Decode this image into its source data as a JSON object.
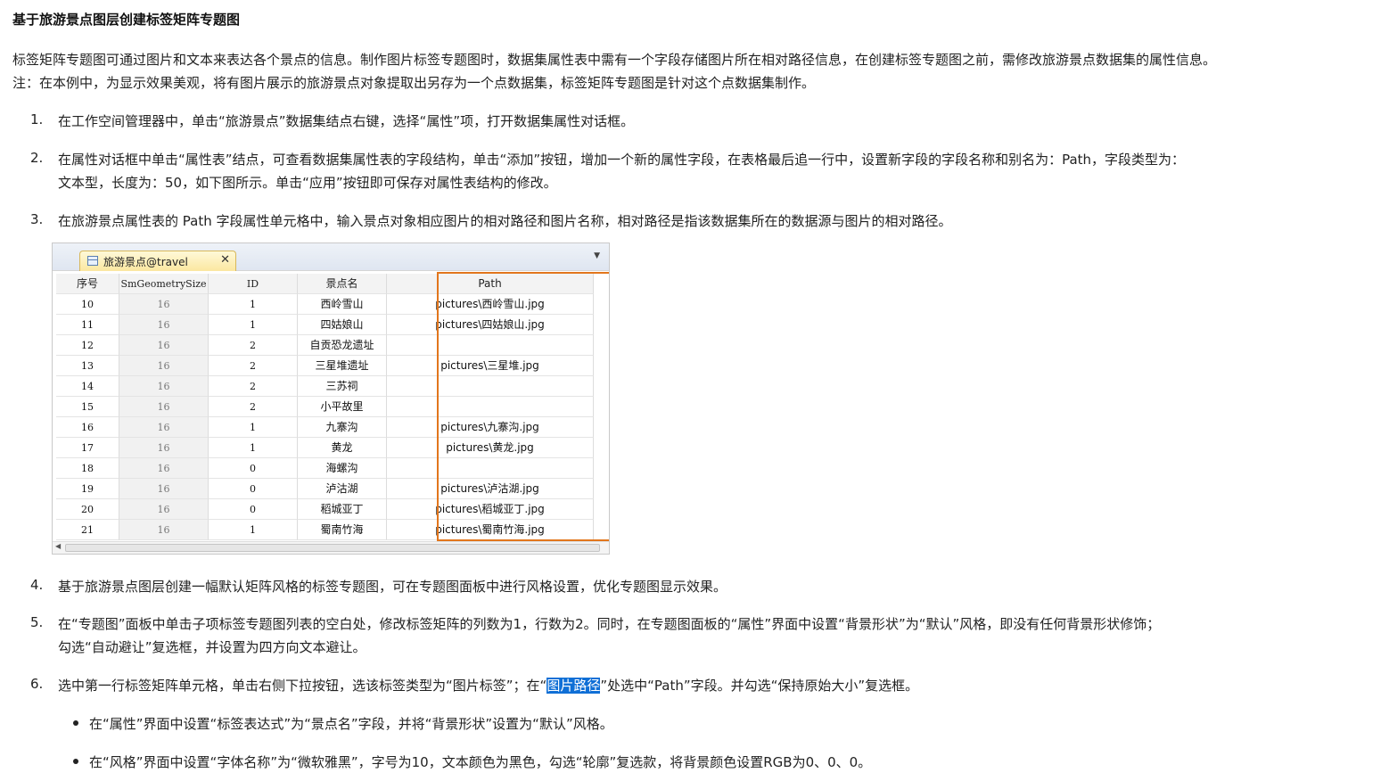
{
  "title": "基于旅游景点图层创建标签矩阵专题图",
  "intro": [
    "标签矩阵专题图可通过图片和文本来表达各个景点的信息。制作图片标签专题图时，数据集属性表中需有一个字段存储图片所在相对路径信息，在创建标签专题图之前，需修改旅游景点数据集的属性信息。",
    "注：在本例中，为显示效果美观，将有图片展示的旅游景点对象提取出另存为一个点数据集，标签矩阵专题图是针对这个点数据集制作。"
  ],
  "steps": [
    {
      "num": "1.",
      "lines": [
        "在工作空间管理器中，单击“旅游景点”数据集结点右键，选择“属性”项，打开数据集属性对话框。"
      ]
    },
    {
      "num": "2.",
      "lines": [
        "在属性对话框中单击“属性表”结点，可查看数据集属性表的字段结构，单击“添加”按钮，增加一个新的属性字段，在表格最后追一行中，设置新字段的字段名称和别名为：Path，字段类型为：",
        "文本型，长度为：50，如下图所示。单击“应用”按钮即可保存对属性表结构的修改。"
      ]
    },
    {
      "num": "3.",
      "lines": [
        "在旅游景点属性表的 Path 字段属性单元格中，输入景点对象相应图片的相对路径和图片名称，相对路径是指该数据集所在的数据源与图片的相对路径。"
      ]
    },
    {
      "num": "4.",
      "lines": [
        "基于旅游景点图层创建一幅默认矩阵风格的标签专题图，可在专题图面板中进行风格设置，优化专题图显示效果。"
      ]
    },
    {
      "num": "5.",
      "lines": [
        "在“专题图”面板中单击子项标签专题图列表的空白处，修改标签矩阵的列数为1，行数为2。同时，在专题图面板的“属性”界面中设置“背景形状”为“默认”风格，即没有任何背景形状修饰；",
        "勾选“自动避让”复选框，并设置为四方向文本避让。"
      ]
    },
    {
      "num": "6.",
      "pre": "选中第一行标签矩阵单元格，单击右侧下拉按钮，选该标签类型为“图片标签”；在“",
      "highlight": "图片路径",
      "post": "”处选中“Path”字段。并勾选“保持原始大小”复选框。"
    }
  ],
  "bullets": [
    "在“属性”界面中设置“标签表达式”为“景点名”字段，并将“背景形状”设置为“默认”风格。",
    "在“风格”界面中设置“字体名称”为“微软雅黑”，字号为10，文本颜色为黑色，勾选“轮廓”复选款，将背景颜色设置RGB为0、0、0。"
  ],
  "table": {
    "tab_label": "旅游景点@travel",
    "tab_close": "✕",
    "headers": [
      "序号",
      "SmGeometrySize",
      "ID",
      "景点名",
      "Path"
    ],
    "rows": [
      [
        "10",
        "16",
        "1",
        "西岭雪山",
        "pictures\\西岭雪山.jpg"
      ],
      [
        "11",
        "16",
        "1",
        "四姑娘山",
        "pictures\\四姑娘山.jpg"
      ],
      [
        "12",
        "16",
        "2",
        "自贡恐龙遗址",
        ""
      ],
      [
        "13",
        "16",
        "2",
        "三星堆遗址",
        "pictures\\三星堆.jpg"
      ],
      [
        "14",
        "16",
        "2",
        "三苏祠",
        ""
      ],
      [
        "15",
        "16",
        "2",
        "小平故里",
        ""
      ],
      [
        "16",
        "16",
        "1",
        "九寨沟",
        "pictures\\九寨沟.jpg"
      ],
      [
        "17",
        "16",
        "1",
        "黄龙",
        "pictures\\黄龙.jpg"
      ],
      [
        "18",
        "16",
        "0",
        "海螺沟",
        ""
      ],
      [
        "19",
        "16",
        "0",
        "泸沽湖",
        "pictures\\泸沽湖.jpg"
      ],
      [
        "20",
        "16",
        "0",
        "稻城亚丁",
        "pictures\\稻城亚丁.jpg"
      ],
      [
        "21",
        "16",
        "1",
        "蜀南竹海",
        "pictures\\蜀南竹海.jpg"
      ]
    ],
    "highlight_color": "#e2761c"
  },
  "colors": {
    "selection": "#0f6fd6",
    "text": "#222222"
  }
}
